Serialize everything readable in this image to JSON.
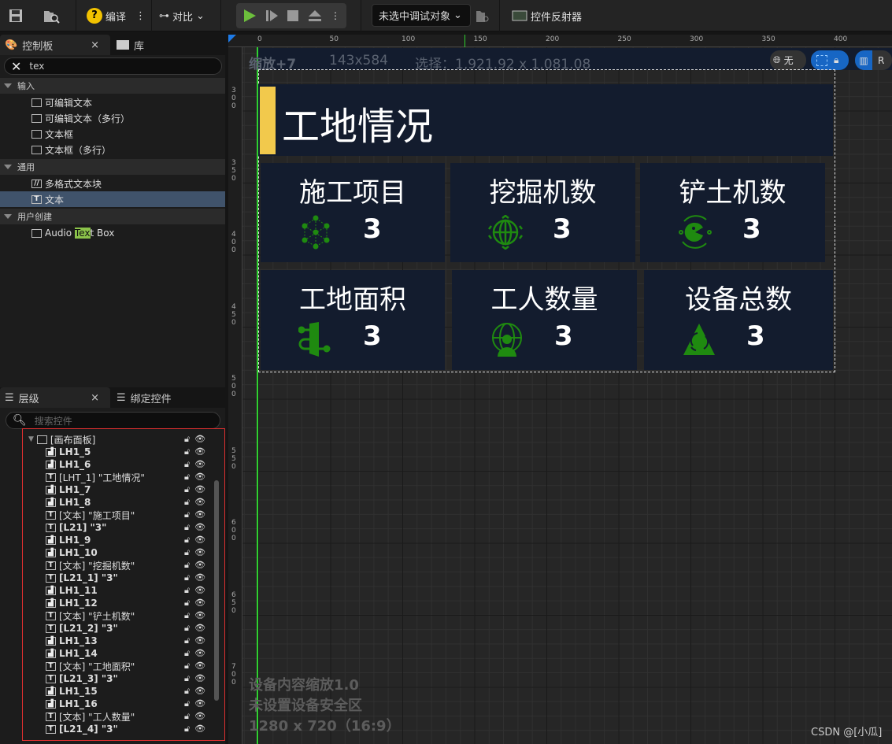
{
  "toolbar": {
    "compile": "编译",
    "diff": "对比",
    "debug_target": "未选中调试对象",
    "widget_reflector": "控件反射器"
  },
  "palette": {
    "tab": "控制板",
    "library_tab": "库",
    "search_value": "tex",
    "categories": [
      {
        "label": "输入",
        "items": [
          {
            "label": "可编辑文本",
            "icon": "editable-text-icon"
          },
          {
            "label": "可编辑文本（多行）",
            "icon": "editable-multiline-icon"
          },
          {
            "label": "文本框",
            "icon": "textbox-icon"
          },
          {
            "label": "文本框（多行）",
            "icon": "textbox-multiline-icon"
          }
        ]
      },
      {
        "label": "通用",
        "items": [
          {
            "label": "多格式文本块",
            "icon": "rich-text-icon"
          },
          {
            "label": "文本",
            "icon": "text-icon",
            "selected": true
          }
        ]
      },
      {
        "label": "用户创建",
        "items": [
          {
            "label_pre": "Audio ",
            "label_hl": "Tex",
            "label_post": "t Box",
            "icon": "user-widget-icon"
          }
        ]
      }
    ]
  },
  "hierarchy": {
    "tab": "层级",
    "bind_tab": "绑定控件",
    "search_placeholder": "搜索控件",
    "root": "[画布面板]",
    "items": [
      {
        "t": "img",
        "n": "LH1_5"
      },
      {
        "t": "img",
        "n": "LH1_6"
      },
      {
        "t": "text",
        "n": "[LHT_1] \"工地情况\""
      },
      {
        "t": "img",
        "n": "LH1_7"
      },
      {
        "t": "img",
        "n": "LH1_8"
      },
      {
        "t": "text",
        "n": "[文本] \"施工项目\""
      },
      {
        "t": "textb",
        "n": "[L21] \"3\""
      },
      {
        "t": "img",
        "n": "LH1_9"
      },
      {
        "t": "img",
        "n": "LH1_10"
      },
      {
        "t": "text",
        "n": "[文本] \"挖掘机数\""
      },
      {
        "t": "textb",
        "n": "[L21_1] \"3\""
      },
      {
        "t": "img",
        "n": "LH1_11"
      },
      {
        "t": "img",
        "n": "LH1_12"
      },
      {
        "t": "text",
        "n": "[文本] \"铲土机数\""
      },
      {
        "t": "textb",
        "n": "[L21_2] \"3\""
      },
      {
        "t": "img",
        "n": "LH1_13"
      },
      {
        "t": "img",
        "n": "LH1_14"
      },
      {
        "t": "text",
        "n": "[文本] \"工地面积\""
      },
      {
        "t": "textb",
        "n": "[L21_3] \"3\""
      },
      {
        "t": "img",
        "n": "LH1_15"
      },
      {
        "t": "img",
        "n": "LH1_16"
      },
      {
        "t": "text",
        "n": "[文本] \"工人数量\""
      },
      {
        "t": "textb",
        "n": "[L21_4] \"3\""
      }
    ]
  },
  "designer": {
    "zoom": "缩放+7",
    "size": "143x584",
    "selection": "选择：1,921.92 x 1,081.08",
    "localization": "无",
    "r": "R",
    "hruler": [
      "0",
      "50",
      "100",
      "150",
      "200",
      "250",
      "300",
      "350",
      "400"
    ],
    "vruler": [
      "300",
      "350",
      "400",
      "450",
      "500",
      "550",
      "600",
      "650",
      "700"
    ],
    "device_scale": "设备内容缩放1.0",
    "safe_zone": "未设置设备安全区",
    "resolution": "1280 x 720（16:9）",
    "watermark": "CSDN @[小瓜]"
  },
  "widget": {
    "header": "工地情况",
    "accent": "#f2c94c",
    "card_bg": "#131c2e",
    "icon_color": "#1f8a10",
    "cards": [
      {
        "title": "施工项目",
        "value": "3",
        "icon": "network-icon"
      },
      {
        "title": "挖掘机数",
        "value": "3",
        "icon": "globe-turtle-icon"
      },
      {
        "title": "铲土机数",
        "value": "3",
        "icon": "pacman-orbit-icon"
      },
      {
        "title": "工地面积",
        "value": "3",
        "icon": "pipeline-icon"
      },
      {
        "title": "工人数量",
        "value": "3",
        "icon": "person-globe-icon"
      },
      {
        "title": "设备总数",
        "value": "3",
        "icon": "recycle-triangle-icon"
      }
    ]
  }
}
